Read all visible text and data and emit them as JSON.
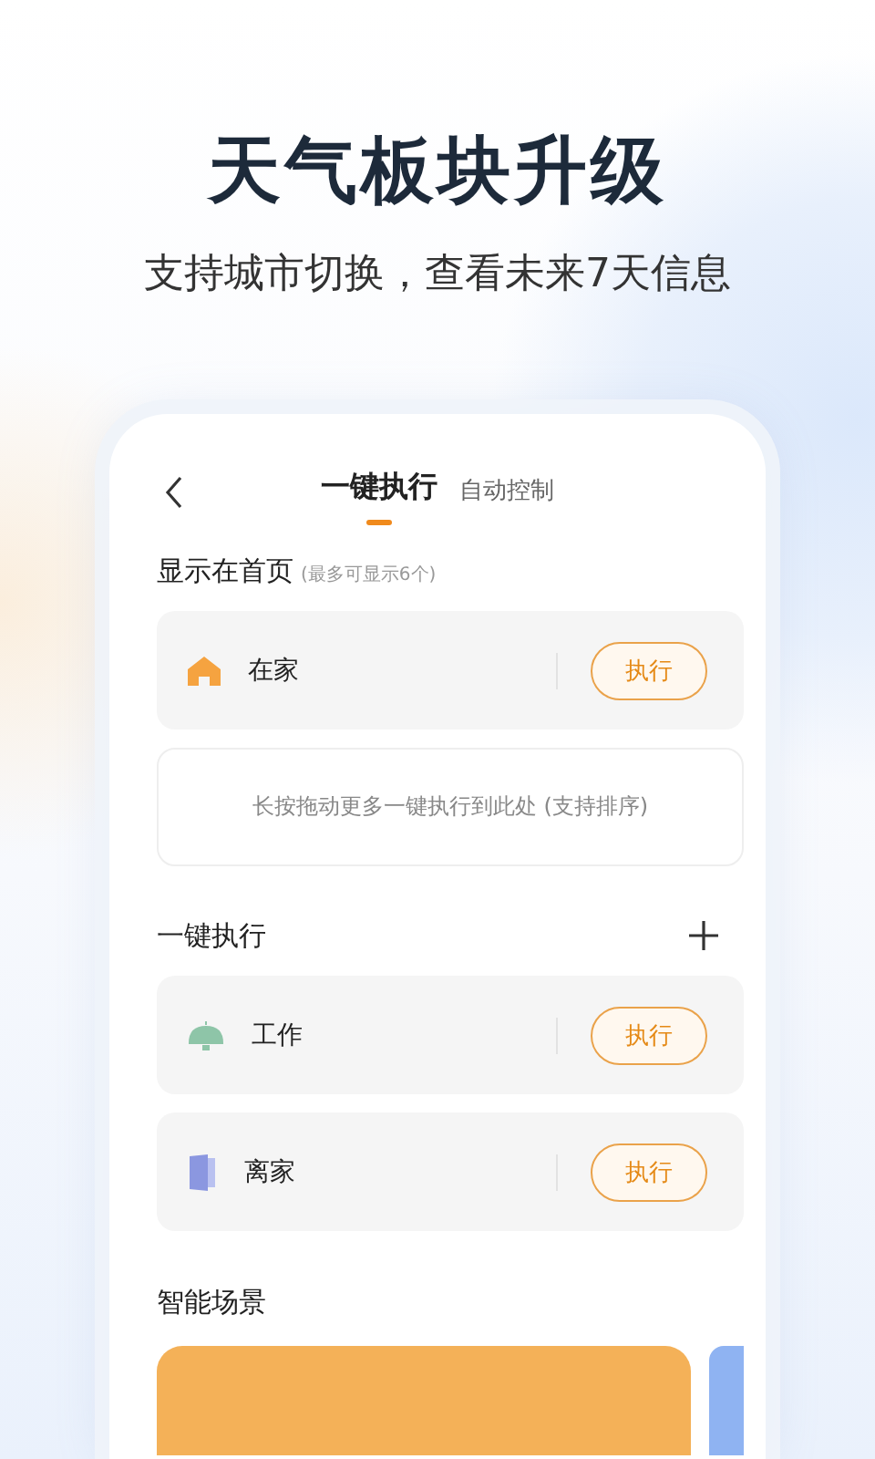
{
  "headline": "天气板块升级",
  "subtitle": "支持城市切换，查看未来7天信息",
  "tabs": [
    {
      "label": "一键执行",
      "selected": true
    },
    {
      "label": "自动控制",
      "selected": false
    }
  ],
  "home_section": {
    "title": "显示在首页",
    "note": "(最多可显示6个)"
  },
  "home_scenes": [
    {
      "kind": "house",
      "name": "在家",
      "action": "执行"
    }
  ],
  "drop_hint": "长按拖动更多一键执行到此处 (支持排序)",
  "quick_section": {
    "title": "一键执行"
  },
  "quick_scenes": [
    {
      "kind": "lamp",
      "name": "工作",
      "action": "执行"
    },
    {
      "kind": "door",
      "name": "离家",
      "action": "执行"
    }
  ],
  "smart_section": {
    "title": "智能场景"
  }
}
